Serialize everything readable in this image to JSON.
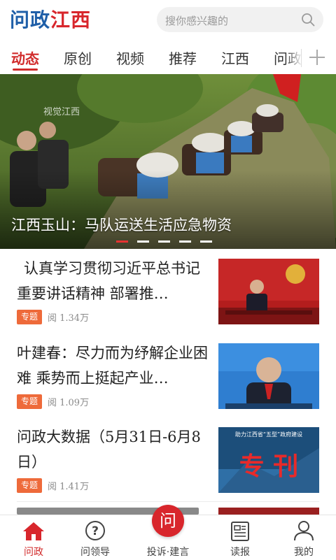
{
  "header": {
    "logo_part1": "问政",
    "logo_part2": "江西",
    "search_placeholder": "搜你感兴趣的"
  },
  "tabs": [
    {
      "label": "动态",
      "active": true
    },
    {
      "label": "原创"
    },
    {
      "label": "视频"
    },
    {
      "label": "推荐"
    },
    {
      "label": "江西"
    },
    {
      "label": "问政"
    }
  ],
  "banner": {
    "watermark": "视觉江西",
    "caption": "江西玉山：马队运送生活应急物资",
    "slide_count": 5,
    "active_slide": 1
  },
  "news": [
    {
      "title": "认真学习贯彻习近平总书记重要讲话精神 部署推…",
      "badge": "专题",
      "reads": "阅 1.34万"
    },
    {
      "title": "叶建春：尽力而为纾解企业困难 乘势而上挺起产业…",
      "badge": "专题",
      "reads": "阅 1.09万"
    },
    {
      "title": "问政大数据（5月31日-6月8日）",
      "badge": "专题",
      "reads": "阅 1.41万",
      "thumb_small": "助力江西省“五型”政府建设",
      "thumb_big": "专 刊"
    }
  ],
  "bottom_nav": [
    {
      "label": "问政",
      "icon": "home-icon",
      "active": true
    },
    {
      "label": "问领导",
      "icon": "question-icon"
    },
    {
      "label": "投诉·建言",
      "icon": "ask-icon",
      "center_text": "问"
    },
    {
      "label": "读报",
      "icon": "newspaper-icon"
    },
    {
      "label": "我的",
      "icon": "user-icon"
    }
  ],
  "colors": {
    "accent": "#d8262c",
    "logo_blue": "#1f5fa8",
    "badge": "#ee6a3a"
  }
}
